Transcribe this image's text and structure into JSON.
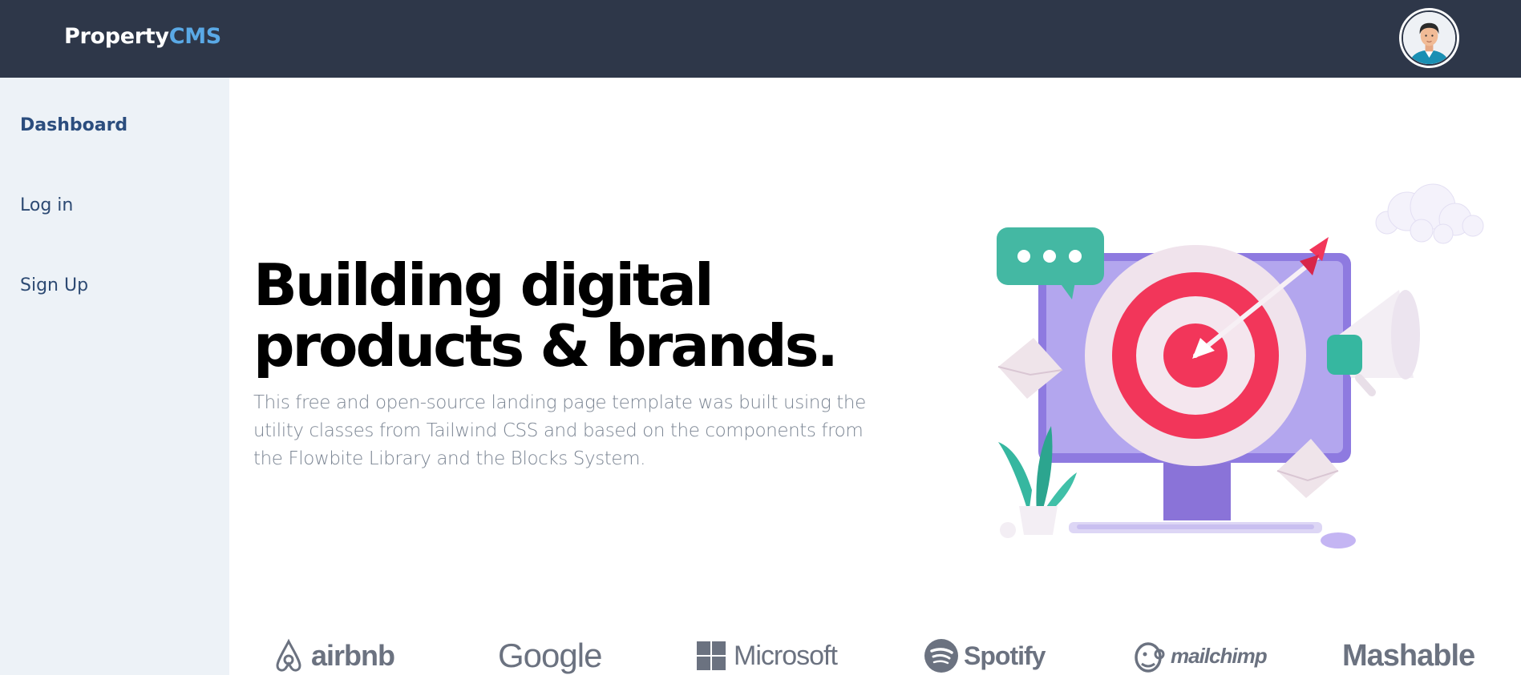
{
  "header": {
    "brand_primary": "Property",
    "brand_accent": "CMS"
  },
  "sidebar": {
    "items": [
      {
        "label": "Dashboard",
        "active": true
      },
      {
        "label": "Log in",
        "active": false
      },
      {
        "label": "Sign Up",
        "active": false
      }
    ]
  },
  "hero": {
    "title_line1": "Building digital",
    "title_line2": "products & brands.",
    "description": "This free and open-source landing page template was built using the utility classes from Tailwind CSS and based on the components from the Flowbite Library and the Blocks System."
  },
  "logos": {
    "airbnb": "airbnb",
    "google": "Google",
    "microsoft": "Microsoft",
    "spotify": "Spotify",
    "mailchimp": "mailchimp",
    "mashable": "Mashable"
  },
  "colors": {
    "topbar": "#2e3749",
    "accent": "#5aa9e6",
    "sidebar": "#edf2f7",
    "nav_text": "#2d4a73",
    "monitor": "#9b87e6",
    "target_red": "#f2365a",
    "teal": "#36b7a0"
  }
}
